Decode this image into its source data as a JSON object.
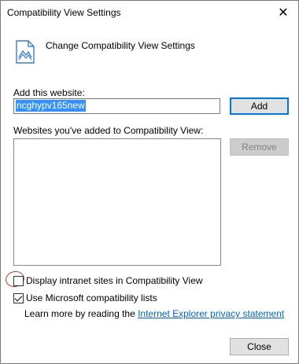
{
  "window": {
    "title": "Compatibility View Settings",
    "close_glyph": "✕"
  },
  "header": {
    "icon": "compatibility-page-icon",
    "title": "Change Compatibility View Settings"
  },
  "add_section": {
    "label": "Add this website:",
    "input_value": "ncghypv165new",
    "add_button": "Add"
  },
  "list_section": {
    "label": "Websites you've added to Compatibility View:",
    "items": [],
    "remove_button": "Remove"
  },
  "options": {
    "intranet": {
      "label": "Display intranet sites in Compatibility View",
      "checked": false
    },
    "ms_lists": {
      "label": "Use Microsoft compatibility lists",
      "checked": true
    }
  },
  "learn_more": {
    "prefix": "Learn more by reading the ",
    "link": "Internet Explorer privacy statement"
  },
  "footer": {
    "close_button": "Close"
  },
  "colors": {
    "selection": "#3390ff",
    "link": "#0066cc",
    "primary_border": "#0078d7",
    "annotation_circle": "#c0392b"
  }
}
